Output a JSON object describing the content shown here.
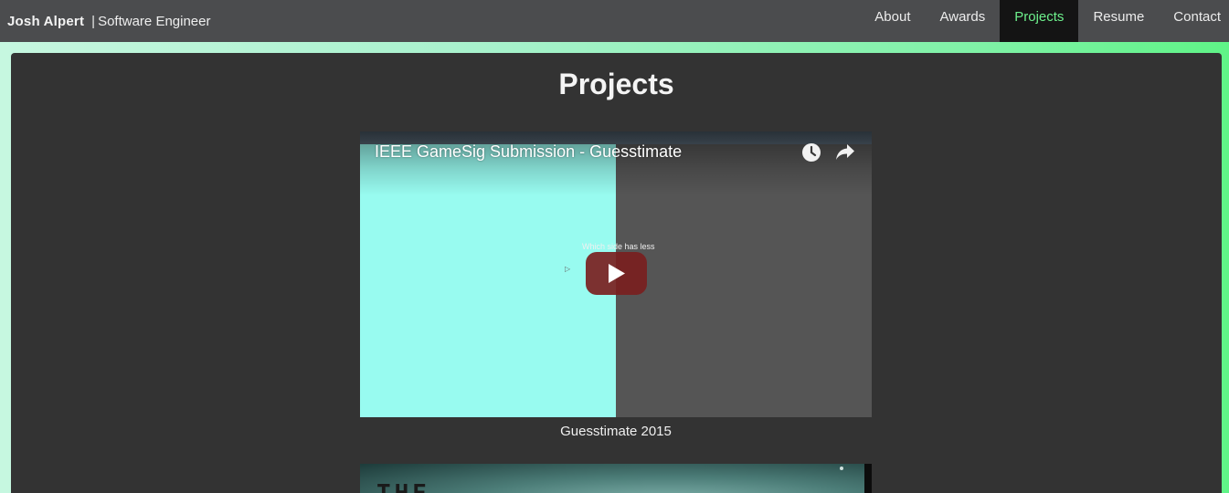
{
  "header": {
    "brand_name": "Josh Alpert",
    "separator": "|",
    "role": "Software Engineer",
    "nav": [
      {
        "label": "About",
        "active": false
      },
      {
        "label": "Awards",
        "active": false
      },
      {
        "label": "Projects",
        "active": true
      },
      {
        "label": "Resume",
        "active": false
      },
      {
        "label": "Contact",
        "active": false
      }
    ]
  },
  "main": {
    "title": "Projects",
    "projects": [
      {
        "video_title": "IEEE GameSig Submission - Guesstimate",
        "overlay_text": "Which side has less",
        "caption": "Guesstimate 2015",
        "icons": [
          "watch-later-icon",
          "share-icon",
          "play-icon"
        ]
      },
      {
        "thumbnail_text": "THE"
      }
    ]
  },
  "colors": {
    "navbar_bg": "#4b4c4e",
    "nav_active_bg": "#141414",
    "nav_active_text": "#6df08c",
    "panel_bg": "#333333",
    "page_gradient_start": "#c6f7e0",
    "page_gradient_end": "#5ff487",
    "video_left_color": "#98fbf0",
    "play_button": "#7a2020"
  }
}
